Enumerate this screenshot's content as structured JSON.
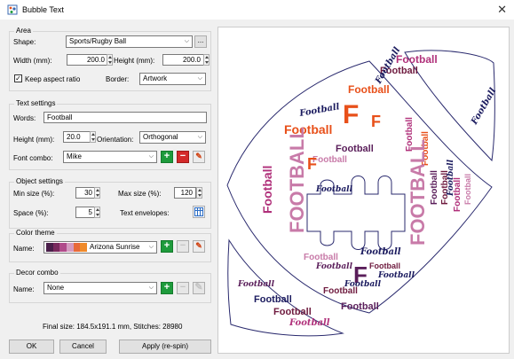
{
  "window": {
    "title": "Bubble Text",
    "close_glyph": "✕"
  },
  "area": {
    "group_label": "Area",
    "shape_label": "Shape:",
    "shape_value": "Sports/Rugby Ball",
    "ellipsis_label": "...",
    "width_label": "Width (mm):",
    "width_value": "200.0",
    "height_label": "Height (mm):",
    "height_value": "200.0",
    "keep_aspect_label": "Keep aspect ratio",
    "keep_aspect_checked": true,
    "border_label": "Border:",
    "border_value": "Artwork"
  },
  "text_settings": {
    "group_label": "Text settings",
    "words_label": "Words:",
    "words_value": "Football",
    "height_label": "Height (mm):",
    "height_value": "20.0",
    "orientation_label": "Orientation:",
    "orientation_value": "Orthogonal",
    "font_combo_label": "Font combo:",
    "font_combo_value": "Mike"
  },
  "object_settings": {
    "group_label": "Object settings",
    "min_size_label": "Min size (%):",
    "min_size_value": "30",
    "max_size_label": "Max size (%):",
    "max_size_value": "120",
    "space_label": "Space (%):",
    "space_value": "5",
    "text_envelopes_label": "Text envelopes:"
  },
  "color_theme": {
    "group_label": "Color theme",
    "name_label": "Name:",
    "name_value": "Arizona Sunrise",
    "swatches": [
      "#4a1f4a",
      "#7a2a5e",
      "#b04a8a",
      "#d49ac0",
      "#e86a3a",
      "#f08a2a"
    ]
  },
  "decor_combo": {
    "group_label": "Decor combo",
    "name_label": "Name:",
    "name_value": "None"
  },
  "status": {
    "final_size": "Final size: 184.5x191.1 mm, Stitches: 28980"
  },
  "buttons": {
    "ok": "OK",
    "cancel": "Cancel",
    "apply": "Apply (re-spin)"
  },
  "icons": {
    "add": "plus-icon",
    "remove": "minus-icon",
    "edit": "pencil-icon",
    "dropdown": "chevron-down-icon",
    "envelope": "grid-icon",
    "app": "bubble-text-icon",
    "close": "close-icon"
  },
  "preview": {
    "word": "Football",
    "word_upper": "FOOTBALL",
    "letter": "F",
    "colors": {
      "navy": "#1a1a5e",
      "maroon": "#6e1a3e",
      "plum": "#5a1e5a",
      "magenta": "#b0307a",
      "pink": "#c87aa8",
      "orange": "#e8501a",
      "amber": "#e86a2a",
      "outline": "#2a2a6e"
    }
  }
}
